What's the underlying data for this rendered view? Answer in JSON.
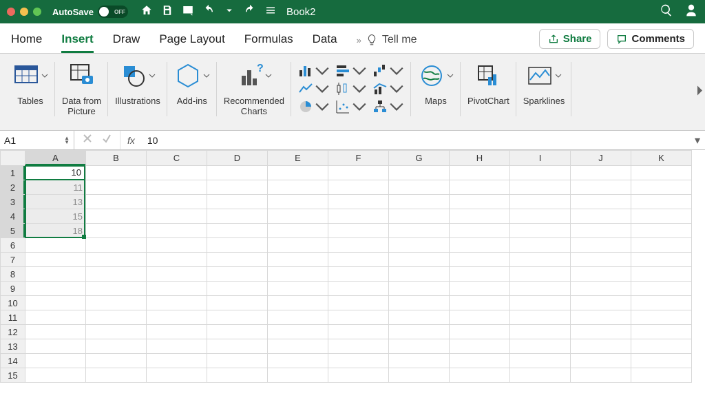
{
  "titlebar": {
    "autosave_label": "AutoSave",
    "autosave_state": "OFF",
    "document_title": "Book2"
  },
  "tabs": {
    "items": [
      "Home",
      "Insert",
      "Draw",
      "Page Layout",
      "Formulas",
      "Data"
    ],
    "active_index": 1,
    "tell_me": "Tell me",
    "share": "Share",
    "comments": "Comments"
  },
  "ribbon": {
    "tables": "Tables",
    "data_from_picture": "Data from\nPicture",
    "illustrations": "Illustrations",
    "addins": "Add-ins",
    "recommended_charts": "Recommended\nCharts",
    "maps": "Maps",
    "pivotchart": "PivotChart",
    "sparklines": "Sparklines"
  },
  "formula_bar": {
    "name_box": "A1",
    "fx_label": "fx",
    "value": "10"
  },
  "sheet": {
    "columns": [
      "A",
      "B",
      "C",
      "D",
      "E",
      "F",
      "G",
      "H",
      "I",
      "J",
      "K"
    ],
    "row_count": 15,
    "cells": {
      "A1": "10",
      "A2": "11",
      "A3": "13",
      "A4": "15",
      "A5": "18"
    },
    "selection": {
      "col": "A",
      "rows": [
        1,
        5
      ],
      "active": "A1"
    }
  }
}
